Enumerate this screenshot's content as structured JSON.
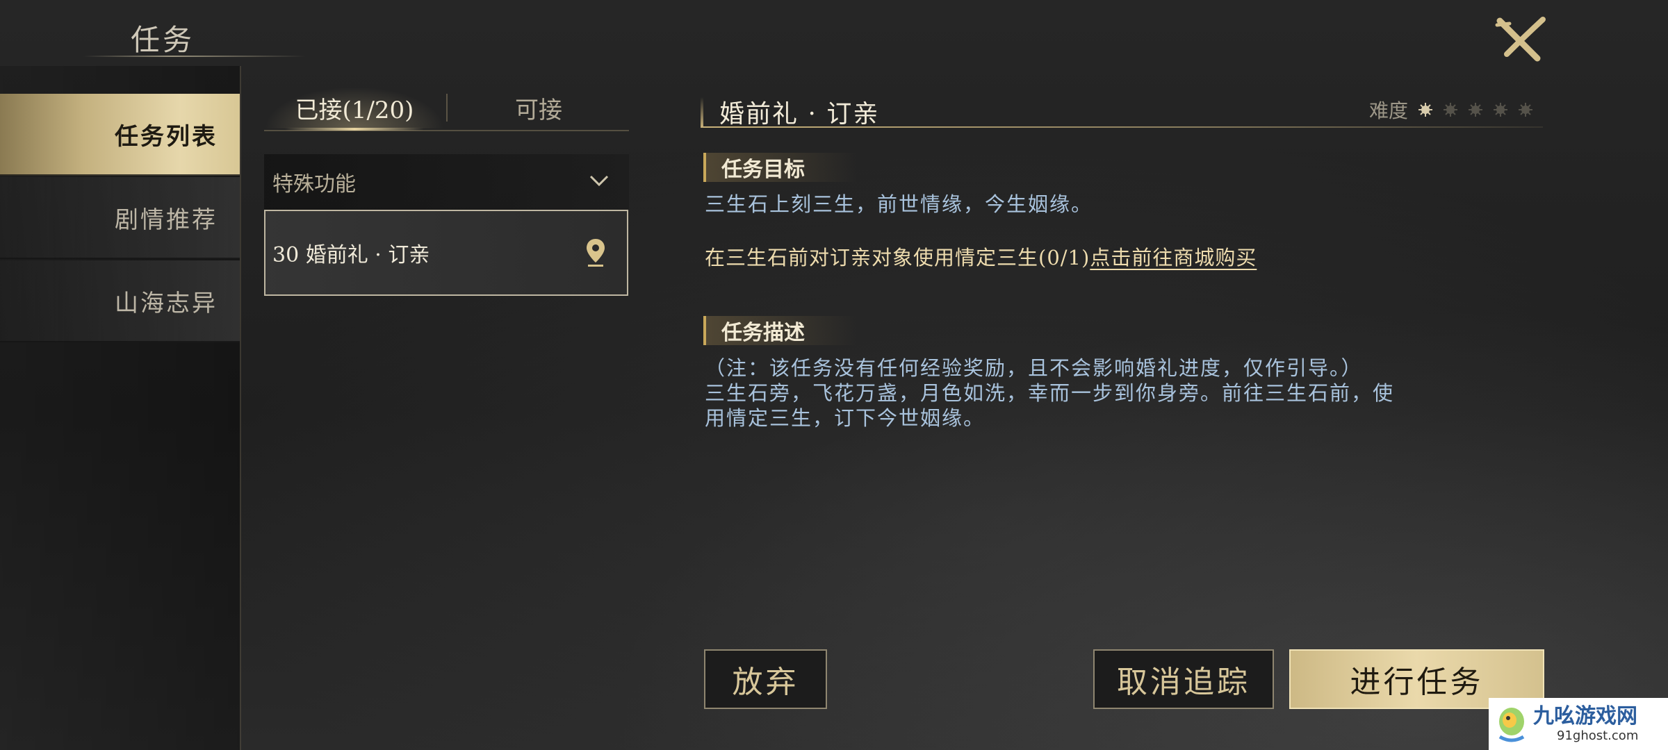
{
  "header": {
    "title": "任务"
  },
  "nav": {
    "items": [
      {
        "label": "任务列表"
      },
      {
        "label": "剧情推荐"
      },
      {
        "label": "山海志异"
      }
    ]
  },
  "tabs": {
    "accepted": "已接(1/20)",
    "available": "可接"
  },
  "category": {
    "label": "特殊功能"
  },
  "quest_list": [
    {
      "label": "30 婚前礼 · 订亲"
    }
  ],
  "detail": {
    "title": "婚前礼 · 订亲",
    "difficulty_label": "难度",
    "difficulty_level": 1,
    "difficulty_max": 5,
    "objective_heading": "任务目标",
    "objective_text": "三生石上刻三生，前世情缘，今生姻缘。",
    "objective_task": "在三生石前对订亲对象使用情定三生(0/1)",
    "objective_link": "点击前往商城购买",
    "description_heading": "任务描述",
    "description_lines": [
      "（注：该任务没有任何经验奖励，且不会影响婚礼进度，仅作引导。）",
      "三生石旁，飞花万盏，月色如洗，幸而一步到你身旁。前往三生石前，使",
      "用情定三生，订下今世姻缘。"
    ]
  },
  "buttons": {
    "abandon": "放弃",
    "untrack": "取消追踪",
    "proceed": "进行任务"
  },
  "watermark": {
    "name": "九吆游戏网",
    "url": "91ghost.com"
  },
  "colors": {
    "accent_gold": "#c9b27a",
    "objective_blue": "#a9c3dd",
    "task_gold": "#eedcae"
  }
}
